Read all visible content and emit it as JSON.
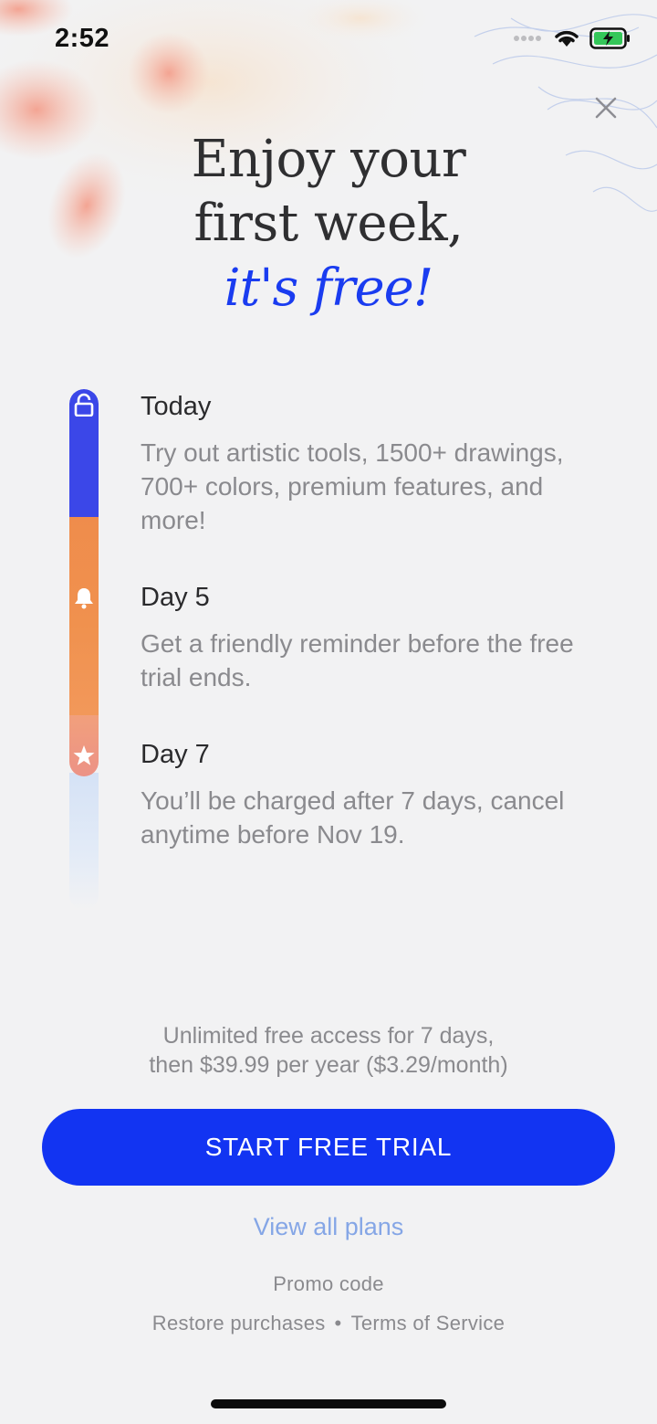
{
  "status_bar": {
    "time": "2:52",
    "icons": [
      "signal-dots-icon",
      "wifi-icon",
      "battery-charging-icon"
    ],
    "battery_color": "#34c759"
  },
  "headline": {
    "line1": "Enjoy your",
    "line2": "first week,",
    "accent": "it's free!",
    "accent_color": "#1a3cf0"
  },
  "timeline": {
    "steps": [
      {
        "icon": "unlock-icon",
        "title": "Today",
        "description": "Try out artistic tools, 1500+ drawings, 700+ colors, premium features, and more!"
      },
      {
        "icon": "bell-icon",
        "title": "Day 5",
        "description": "Get a friendly reminder before the free trial ends."
      },
      {
        "icon": "star-icon",
        "title": "Day 7",
        "description": "You’ll be charged after 7 days, cancel anytime before Nov 19."
      }
    ],
    "colors": [
      "#3b47e8",
      "#f0914e",
      "#ec9286",
      "#d5e2f6"
    ]
  },
  "pricing": {
    "line1": "Unlimited free access for 7 days,",
    "line2": "then $39.99 per year ($3.29/month)"
  },
  "cta": {
    "label": "START FREE TRIAL",
    "color": "#1234f2"
  },
  "links": {
    "view_all_plans": "View all plans",
    "promo_code": "Promo code",
    "restore_purchases": "Restore purchases",
    "separator": "•",
    "terms": "Terms of Service"
  }
}
